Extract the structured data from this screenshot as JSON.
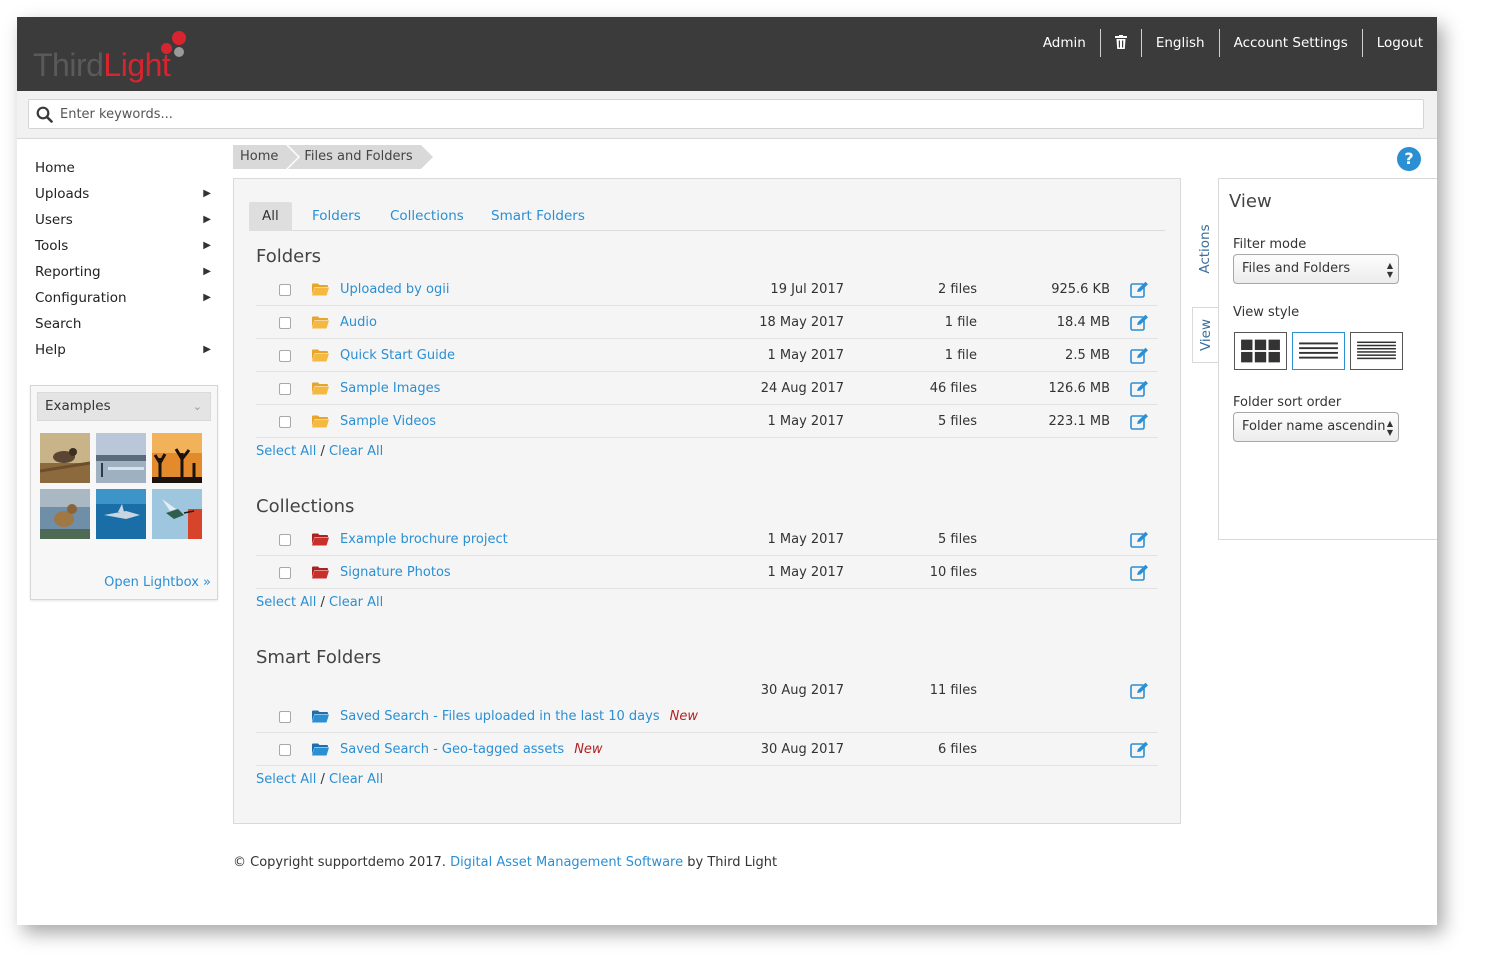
{
  "brand": {
    "third": "Third",
    "light": "Light"
  },
  "topnav": {
    "admin": "Admin",
    "language": "English",
    "account": "Account Settings",
    "logout": "Logout"
  },
  "search": {
    "placeholder": "Enter keywords..."
  },
  "leftnav": {
    "items": [
      {
        "label": "Home",
        "submenu": false
      },
      {
        "label": "Uploads",
        "submenu": true
      },
      {
        "label": "Users",
        "submenu": true
      },
      {
        "label": "Tools",
        "submenu": true
      },
      {
        "label": "Reporting",
        "submenu": true
      },
      {
        "label": "Configuration",
        "submenu": true
      },
      {
        "label": "Search",
        "submenu": false
      },
      {
        "label": "Help",
        "submenu": true
      }
    ]
  },
  "lightbox": {
    "title": "Examples",
    "open_link": "Open Lightbox »"
  },
  "breadcrumb": [
    "Home",
    "Files and Folders"
  ],
  "tabs": [
    "All",
    "Folders",
    "Collections",
    "Smart Folders"
  ],
  "active_tab": "All",
  "folders": {
    "title": "Folders",
    "rows": [
      {
        "name": "Uploaded by ogii",
        "date": "19 Jul 2017",
        "count": "2 files",
        "size": "925.6 KB"
      },
      {
        "name": "Audio",
        "date": "18 May 2017",
        "count": "1 file",
        "size": "18.4 MB"
      },
      {
        "name": "Quick Start Guide",
        "date": "1 May 2017",
        "count": "1 file",
        "size": "2.5 MB"
      },
      {
        "name": "Sample Images",
        "date": "24 Aug 2017",
        "count": "46 files",
        "size": "126.6 MB"
      },
      {
        "name": "Sample Videos",
        "date": "1 May 2017",
        "count": "5 files",
        "size": "223.1 MB"
      }
    ]
  },
  "collections": {
    "title": "Collections",
    "rows": [
      {
        "name": "Example brochure project",
        "date": "1 May 2017",
        "count": "5 files"
      },
      {
        "name": "Signature Photos",
        "date": "1 May 2017",
        "count": "10 files"
      }
    ]
  },
  "smart_folders": {
    "title": "Smart Folders",
    "rows": [
      {
        "name": "Saved Search - Files uploaded in the last 10 days",
        "badge": "New",
        "date": "30 Aug 2017",
        "count": "11 files"
      },
      {
        "name": "Saved Search - Geo-tagged assets",
        "badge": "New",
        "date": "30 Aug 2017",
        "count": "6 files"
      }
    ]
  },
  "select_all": "Select All",
  "clear_all": "Clear All",
  "side_tabs": {
    "actions": "Actions",
    "view": "View"
  },
  "view_panel": {
    "title": "View",
    "filter_label": "Filter mode",
    "filter_value": "Files and Folders",
    "style_label": "View style",
    "style_selected": "list",
    "sort_label": "Folder sort order",
    "sort_value": "Folder name ascendin"
  },
  "footer": {
    "prefix": "© Copyright supportdemo 2017.",
    "link": "Digital Asset Management Software",
    "suffix": "by Third Light"
  },
  "colors": {
    "header": "#3b3b3b",
    "accent": "#2b8fd3",
    "brand_red": "#d8242f",
    "folder_yellow": "#f5b942",
    "collection_red": "#c9302c",
    "smart_blue": "#2b8fd3",
    "new_badge": "#b22222"
  }
}
